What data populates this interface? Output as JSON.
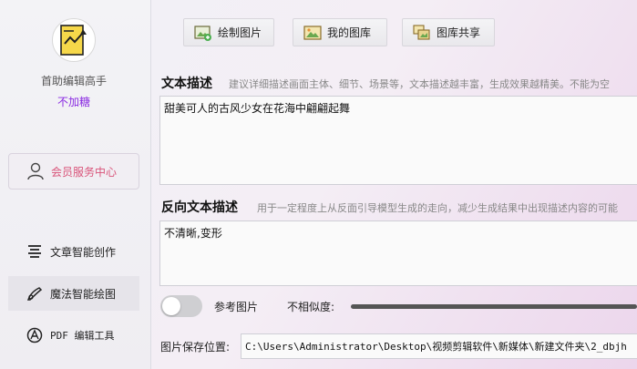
{
  "sidebar": {
    "app_name": "首助编辑高手",
    "app_subtitle": "不加糖",
    "member_label": "会员服务中心",
    "items": [
      {
        "label": "文章智能创作",
        "icon": "list-icon"
      },
      {
        "label": "魔法智能绘图",
        "icon": "magic-wand-icon"
      },
      {
        "label": "PDF 编辑工具",
        "icon": "pdf-icon"
      }
    ],
    "active_item": "魔法智能绘图"
  },
  "tabs": [
    {
      "label": "绘制图片",
      "icon": "draw-image-icon"
    },
    {
      "label": "我的图库",
      "icon": "gallery-icon"
    },
    {
      "label": "图库共享",
      "icon": "share-icon"
    }
  ],
  "text_desc": {
    "label": "文本描述",
    "hint": "建议详细描述画面主体、细节、场景等，文本描述越丰富，生成效果越精美。不能为空",
    "value": "甜美可人的古风少女在花海中翩翩起舞"
  },
  "neg_desc": {
    "label": "反向文本描述",
    "hint": "用于一定程度上从反面引导模型生成的走向，减少生成结果中出现描述内容的可能",
    "value": "不清晰,变形"
  },
  "options": {
    "ref_image_label": "参考图片",
    "dissimilarity_label": "不相似度:"
  },
  "save": {
    "label": "图片保存位置:",
    "path": "C:\\Users\\Administrator\\Desktop\\视频剪辑软件\\新媒体\\新建文件夹\\2_dbjh"
  },
  "colors": {
    "accent_purple": "#8a2be2",
    "member_pink": "#d9547a"
  }
}
